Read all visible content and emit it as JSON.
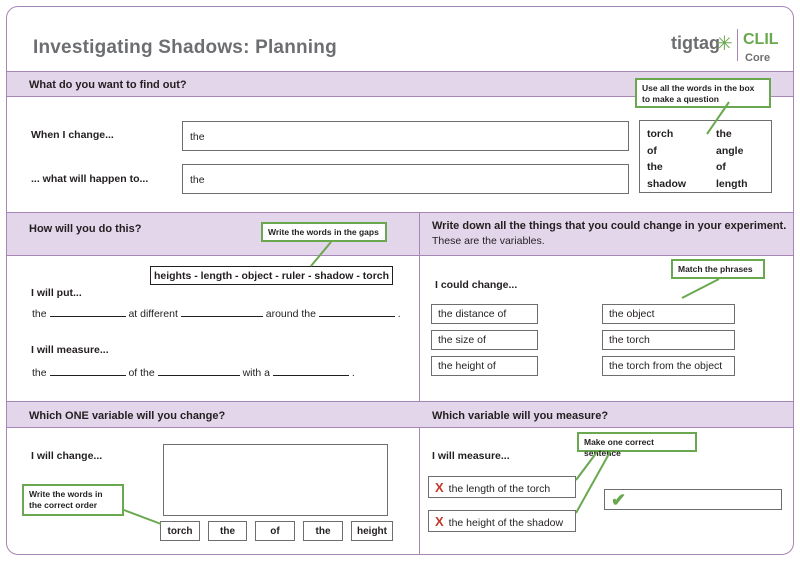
{
  "header": {
    "title": "Investigating Shadows: Planning",
    "logo": {
      "brand": "tigtag",
      "product": "CLIL",
      "level": "Core"
    }
  },
  "section1": {
    "heading": "What do you want to find out?",
    "when_label": "When I change...",
    "when_value": "the",
    "what_label": "... what will happen to...",
    "what_value": "the",
    "note": "Use all the words in the box to make a question",
    "words": [
      [
        "torch",
        "the"
      ],
      [
        "of",
        "angle"
      ],
      [
        "the",
        "of"
      ],
      [
        "shadow",
        "length"
      ]
    ]
  },
  "section2": {
    "heading": "How will you do this?",
    "note": "Write the words in the gaps",
    "word_bank": "heights - length - object - ruler - shadow - torch",
    "put_label": "I will put...",
    "put_line": {
      "a": "the",
      "b": "at different",
      "c": "around the",
      "d": "."
    },
    "measure_label": "I will measure...",
    "measure_line": {
      "a": "the",
      "b": "of the",
      "c": "with a",
      "d": "."
    }
  },
  "section3": {
    "heading": "Write down all the things that you could change in your experiment.",
    "subheading": "These are the variables.",
    "could_label": "I could change...",
    "note": "Match the phrases",
    "left": [
      "the distance of",
      "the size of",
      "the height of"
    ],
    "right": [
      "the object",
      "the torch",
      "the torch from the object"
    ]
  },
  "section4": {
    "heading": "Which ONE variable will you change?",
    "change_label": "I will change...",
    "note": "Write the words in the correct order",
    "words": [
      "torch",
      "the",
      "of",
      "the",
      "height"
    ]
  },
  "section5": {
    "heading": "Which variable will you measure?",
    "measure_label": "I will measure...",
    "note": "Make one correct sentence",
    "option1": "the length of the torch",
    "option2": "the height of the shadow",
    "cross": "X",
    "tick": "✔"
  },
  "colors": {
    "purple_band": "#e3d5ea",
    "purple_border": "#a586b5",
    "green": "#6aa84f",
    "red": "#c0392b",
    "grey_title": "#6d6e71"
  }
}
